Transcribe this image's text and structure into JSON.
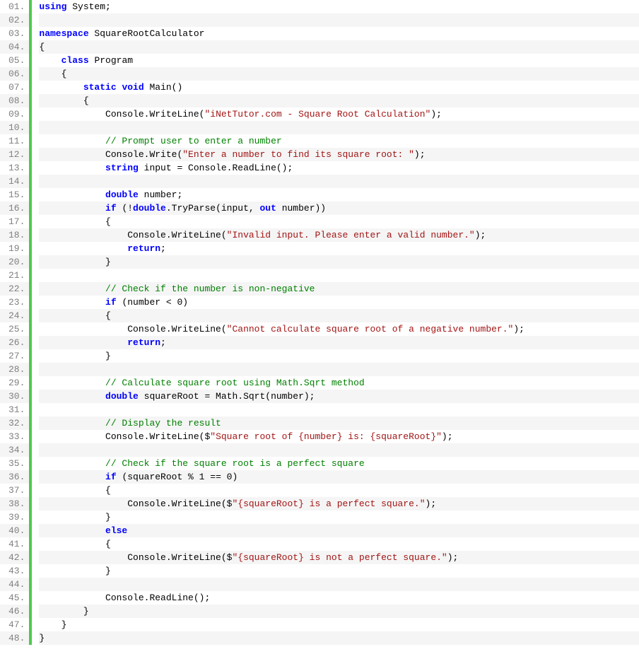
{
  "lines": [
    {
      "n": "01.",
      "indent": 0,
      "tokens": [
        [
          "kw",
          "using"
        ],
        [
          "id",
          " System;"
        ]
      ]
    },
    {
      "n": "02.",
      "indent": 0,
      "tokens": []
    },
    {
      "n": "03.",
      "indent": 0,
      "tokens": [
        [
          "kw",
          "namespace"
        ],
        [
          "id",
          " SquareRootCalculator"
        ]
      ]
    },
    {
      "n": "04.",
      "indent": 0,
      "tokens": [
        [
          "punc",
          "{"
        ]
      ]
    },
    {
      "n": "05.",
      "indent": 1,
      "tokens": [
        [
          "kw",
          "class"
        ],
        [
          "id",
          " Program"
        ]
      ]
    },
    {
      "n": "06.",
      "indent": 1,
      "tokens": [
        [
          "punc",
          "{"
        ]
      ]
    },
    {
      "n": "07.",
      "indent": 2,
      "tokens": [
        [
          "kw",
          "static"
        ],
        [
          "id",
          " "
        ],
        [
          "kw",
          "void"
        ],
        [
          "id",
          " Main()"
        ]
      ]
    },
    {
      "n": "08.",
      "indent": 2,
      "tokens": [
        [
          "punc",
          "{"
        ]
      ]
    },
    {
      "n": "09.",
      "indent": 3,
      "tokens": [
        [
          "id",
          "Console.WriteLine("
        ],
        [
          "str",
          "\"iNetTutor.com - Square Root Calculation\""
        ],
        [
          "id",
          ");"
        ]
      ]
    },
    {
      "n": "10.",
      "indent": 0,
      "tokens": []
    },
    {
      "n": "11.",
      "indent": 3,
      "tokens": [
        [
          "com",
          "// Prompt user to enter a number"
        ]
      ]
    },
    {
      "n": "12.",
      "indent": 3,
      "tokens": [
        [
          "id",
          "Console.Write("
        ],
        [
          "str",
          "\"Enter a number to find its square root: \""
        ],
        [
          "id",
          ");"
        ]
      ]
    },
    {
      "n": "13.",
      "indent": 3,
      "tokens": [
        [
          "kw",
          "string"
        ],
        [
          "id",
          " input = Console.ReadLine();"
        ]
      ]
    },
    {
      "n": "14.",
      "indent": 0,
      "tokens": []
    },
    {
      "n": "15.",
      "indent": 3,
      "tokens": [
        [
          "kw",
          "double"
        ],
        [
          "id",
          " number;"
        ]
      ]
    },
    {
      "n": "16.",
      "indent": 3,
      "tokens": [
        [
          "kw",
          "if"
        ],
        [
          "id",
          " (!"
        ],
        [
          "kw",
          "double"
        ],
        [
          "id",
          ".TryParse(input, "
        ],
        [
          "kw",
          "out"
        ],
        [
          "id",
          " number))"
        ]
      ]
    },
    {
      "n": "17.",
      "indent": 3,
      "tokens": [
        [
          "punc",
          "{"
        ]
      ]
    },
    {
      "n": "18.",
      "indent": 4,
      "tokens": [
        [
          "id",
          "Console.WriteLine("
        ],
        [
          "str",
          "\"Invalid input. Please enter a valid number.\""
        ],
        [
          "id",
          ");"
        ]
      ]
    },
    {
      "n": "19.",
      "indent": 4,
      "tokens": [
        [
          "kw",
          "return"
        ],
        [
          "id",
          ";"
        ]
      ]
    },
    {
      "n": "20.",
      "indent": 3,
      "tokens": [
        [
          "punc",
          "}"
        ]
      ]
    },
    {
      "n": "21.",
      "indent": 0,
      "tokens": []
    },
    {
      "n": "22.",
      "indent": 3,
      "tokens": [
        [
          "com",
          "// Check if the number is non-negative"
        ]
      ]
    },
    {
      "n": "23.",
      "indent": 3,
      "tokens": [
        [
          "kw",
          "if"
        ],
        [
          "id",
          " (number < 0)"
        ]
      ]
    },
    {
      "n": "24.",
      "indent": 3,
      "tokens": [
        [
          "punc",
          "{"
        ]
      ]
    },
    {
      "n": "25.",
      "indent": 4,
      "tokens": [
        [
          "id",
          "Console.WriteLine("
        ],
        [
          "str",
          "\"Cannot calculate square root of a negative number.\""
        ],
        [
          "id",
          ");"
        ]
      ]
    },
    {
      "n": "26.",
      "indent": 4,
      "tokens": [
        [
          "kw",
          "return"
        ],
        [
          "id",
          ";"
        ]
      ]
    },
    {
      "n": "27.",
      "indent": 3,
      "tokens": [
        [
          "punc",
          "}"
        ]
      ]
    },
    {
      "n": "28.",
      "indent": 0,
      "tokens": []
    },
    {
      "n": "29.",
      "indent": 3,
      "tokens": [
        [
          "com",
          "// Calculate square root using Math.Sqrt method"
        ]
      ]
    },
    {
      "n": "30.",
      "indent": 3,
      "tokens": [
        [
          "kw",
          "double"
        ],
        [
          "id",
          " squareRoot = Math.Sqrt(number);"
        ]
      ]
    },
    {
      "n": "31.",
      "indent": 0,
      "tokens": []
    },
    {
      "n": "32.",
      "indent": 3,
      "tokens": [
        [
          "com",
          "// Display the result"
        ]
      ]
    },
    {
      "n": "33.",
      "indent": 3,
      "tokens": [
        [
          "id",
          "Console.WriteLine($"
        ],
        [
          "str",
          "\"Square root of {number} is: {squareRoot}\""
        ],
        [
          "id",
          ");"
        ]
      ]
    },
    {
      "n": "34.",
      "indent": 0,
      "tokens": []
    },
    {
      "n": "35.",
      "indent": 3,
      "tokens": [
        [
          "com",
          "// Check if the square root is a perfect square"
        ]
      ]
    },
    {
      "n": "36.",
      "indent": 3,
      "tokens": [
        [
          "kw",
          "if"
        ],
        [
          "id",
          " (squareRoot % 1 == 0)"
        ]
      ]
    },
    {
      "n": "37.",
      "indent": 3,
      "tokens": [
        [
          "punc",
          "{"
        ]
      ]
    },
    {
      "n": "38.",
      "indent": 4,
      "tokens": [
        [
          "id",
          "Console.WriteLine($"
        ],
        [
          "str",
          "\"{squareRoot} is a perfect square.\""
        ],
        [
          "id",
          ");"
        ]
      ]
    },
    {
      "n": "39.",
      "indent": 3,
      "tokens": [
        [
          "punc",
          "}"
        ]
      ]
    },
    {
      "n": "40.",
      "indent": 3,
      "tokens": [
        [
          "kw",
          "else"
        ]
      ]
    },
    {
      "n": "41.",
      "indent": 3,
      "tokens": [
        [
          "punc",
          "{"
        ]
      ]
    },
    {
      "n": "42.",
      "indent": 4,
      "tokens": [
        [
          "id",
          "Console.WriteLine($"
        ],
        [
          "str",
          "\"{squareRoot} is not a perfect square.\""
        ],
        [
          "id",
          ");"
        ]
      ]
    },
    {
      "n": "43.",
      "indent": 3,
      "tokens": [
        [
          "punc",
          "}"
        ]
      ]
    },
    {
      "n": "44.",
      "indent": 0,
      "tokens": []
    },
    {
      "n": "45.",
      "indent": 3,
      "tokens": [
        [
          "id",
          "Console.ReadLine();"
        ]
      ]
    },
    {
      "n": "46.",
      "indent": 2,
      "tokens": [
        [
          "punc",
          "}"
        ]
      ]
    },
    {
      "n": "47.",
      "indent": 1,
      "tokens": [
        [
          "punc",
          "}"
        ]
      ]
    },
    {
      "n": "48.",
      "indent": 0,
      "tokens": [
        [
          "punc",
          "}"
        ]
      ]
    }
  ],
  "indent_unit": "    "
}
